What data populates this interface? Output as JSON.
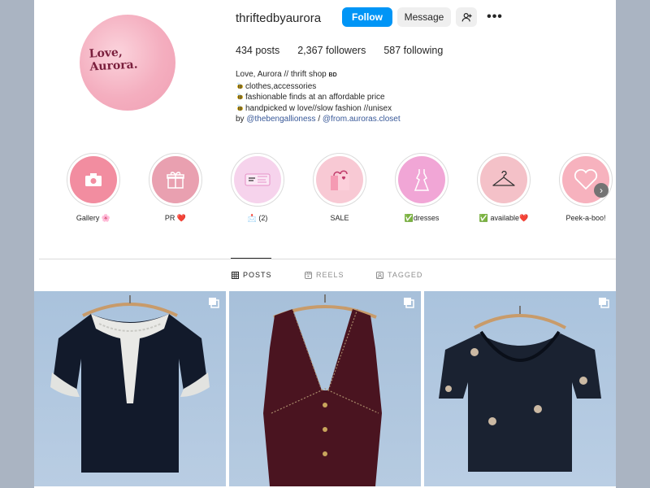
{
  "profile": {
    "username": "thriftedbyaurora",
    "avatar_text_line1": "Love,",
    "avatar_text_line2": "Aurora.",
    "follow_label": "Follow",
    "message_label": "Message",
    "posts_count": "434",
    "posts_label": "posts",
    "followers_count": "2,367",
    "followers_label": "followers",
    "following_count": "587",
    "following_label": "following"
  },
  "bio": {
    "name": "Love, Aurora // thrift shop",
    "flag": "BD",
    "line1": "clothes,accessories",
    "line2": "fashionable finds at an affordable price",
    "line3": "handpicked w love//slow fashion //unisex",
    "by_prefix": "by",
    "link1": "@thebengallioness",
    "separator": "/",
    "link2": "@from.auroras.closet"
  },
  "highlights": [
    {
      "label": "Gallery 🌸",
      "icon": "camera-icon",
      "color": "#f28da0"
    },
    {
      "label": "PR ❤️",
      "icon": "gift-icon",
      "color": "#e9a0b0"
    },
    {
      "label": "📩 (2)",
      "icon": "coupon-icon",
      "color": "#f6d3ec"
    },
    {
      "label": "SALE",
      "icon": "shopping-bag-icon",
      "color": "#f8c9d4"
    },
    {
      "label": "✅dresses",
      "icon": "dress-icon",
      "color": "#f1a6d6"
    },
    {
      "label": "✅ available❤️",
      "icon": "hanger-icon",
      "color": "#f4c1c8"
    },
    {
      "label": "Peek-a-boo!",
      "icon": "heart-icon",
      "color": "#f7b2be"
    }
  ],
  "tabs": {
    "posts": "POSTS",
    "reels": "REELS",
    "tagged": "TAGGED"
  },
  "posts": [
    {
      "icon": "multiple-images-icon",
      "item": "black top with white lace collar"
    },
    {
      "icon": "multiple-images-icon",
      "item": "maroon vest"
    },
    {
      "icon": "multiple-images-icon",
      "item": "black sheer top"
    }
  ]
}
